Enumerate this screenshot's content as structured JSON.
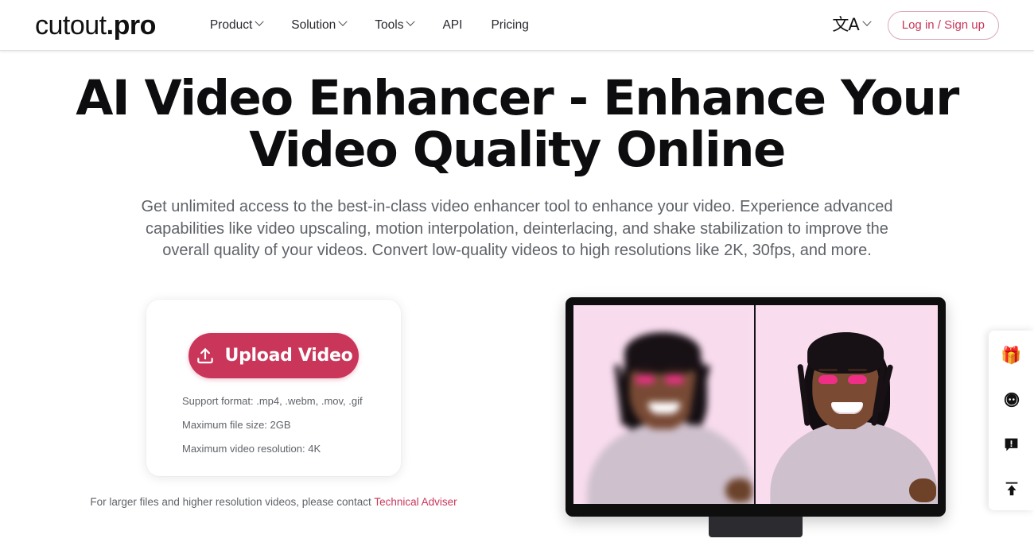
{
  "header": {
    "logo_text": "cutout",
    "logo_suffix": ".pro",
    "nav": [
      {
        "label": "Product",
        "has_dropdown": true
      },
      {
        "label": "Solution",
        "has_dropdown": true
      },
      {
        "label": "Tools",
        "has_dropdown": true
      },
      {
        "label": "API",
        "has_dropdown": false
      },
      {
        "label": "Pricing",
        "has_dropdown": false
      }
    ],
    "language_glyph": "文A",
    "login_label": "Log in / Sign up"
  },
  "hero": {
    "title": "AI Video Enhancer - Enhance Your Video Quality Online",
    "subtitle": "Get unlimited access to the best-in-class video enhancer tool to enhance your video. Experience advanced capabilities like video upscaling, motion interpolation, deinterlacing, and shake stabilization to improve the overall quality of your videos. Convert low-quality videos to high resolutions like 2K, 30fps, and more."
  },
  "upload": {
    "button_label": "Upload Video",
    "notes": [
      "Support format: .mp4, .webm, .mov, .gif",
      "Maximum file size: 2GB",
      "Maximum video resolution: 4K"
    ],
    "contact_prefix": "For larger files and higher resolution videos, please contact ",
    "contact_link": "Technical Adviser"
  },
  "preview": {
    "caption_left": "",
    "caption_right": ""
  },
  "dock": {
    "items": [
      {
        "name": "gift",
        "glyph": "🎁"
      },
      {
        "name": "avatar",
        "glyph": ""
      },
      {
        "name": "feedback",
        "glyph": ""
      },
      {
        "name": "back-to-top",
        "glyph": ""
      }
    ]
  },
  "colors": {
    "accent": "#c9365a",
    "text": "#0d0d0f",
    "muted": "#5f6368",
    "screen_bg": "#f9dcee"
  }
}
